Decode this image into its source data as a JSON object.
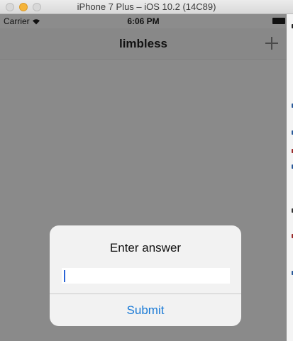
{
  "window": {
    "title": "iPhone 7 Plus – iOS 10.2 (14C89)"
  },
  "statusbar": {
    "carrier": "Carrier",
    "time": "6:06 PM"
  },
  "navbar": {
    "title": "limbless",
    "add_icon": "plus-icon"
  },
  "alert": {
    "title": "Enter answer",
    "input_value": "",
    "submit_label": "Submit"
  },
  "colors": {
    "accent": "#1a7ad6",
    "dim_background": "#8a8a8a",
    "traffic_yellow": "#f5b43a"
  }
}
